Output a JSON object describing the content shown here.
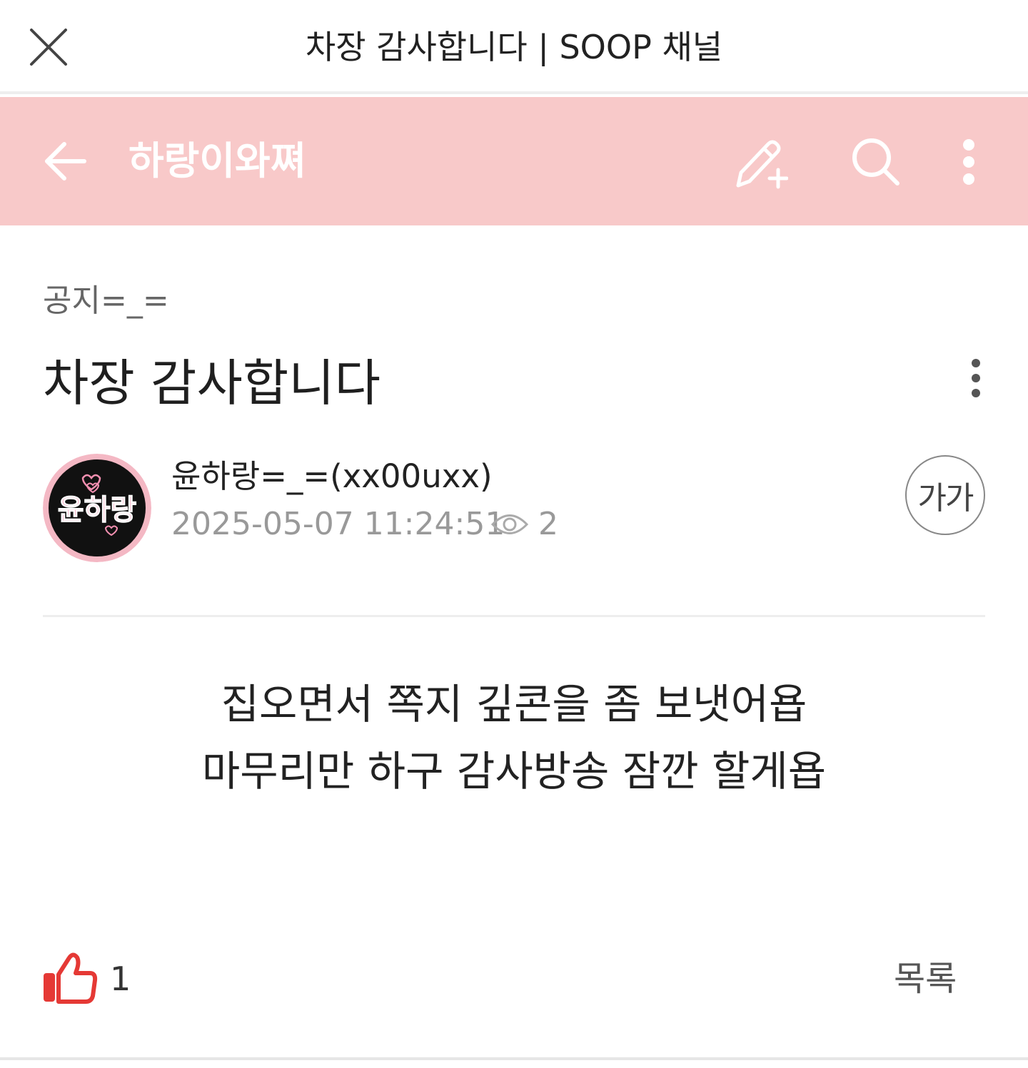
{
  "webview": {
    "title": "차장 감사합니다 | SOOP 채널",
    "close_icon": "close-icon"
  },
  "header": {
    "channel_name": "하랑이와쪄",
    "background_color": "#f8c9c9",
    "back_icon": "back-arrow-icon",
    "write_icon": "write-post-icon",
    "search_icon": "search-icon",
    "menu_icon": "more-vertical-icon"
  },
  "post": {
    "category": "공지=_=",
    "title": "차장 감사합니다",
    "author": "윤하랑=_=(xx00uxx)",
    "date": "2025-05-07 11:24:51",
    "views": "2",
    "font_size_label": "가가",
    "avatar_text": "윤하랑",
    "body_lines": [
      "집오면서 쪽지 깊콘을 좀 보냇어욥",
      "마무리만 하구 감사방송 잠깐 할게욥"
    ]
  },
  "footer": {
    "like_count": "1",
    "list_label": "목록",
    "like_color": "#e53935"
  }
}
